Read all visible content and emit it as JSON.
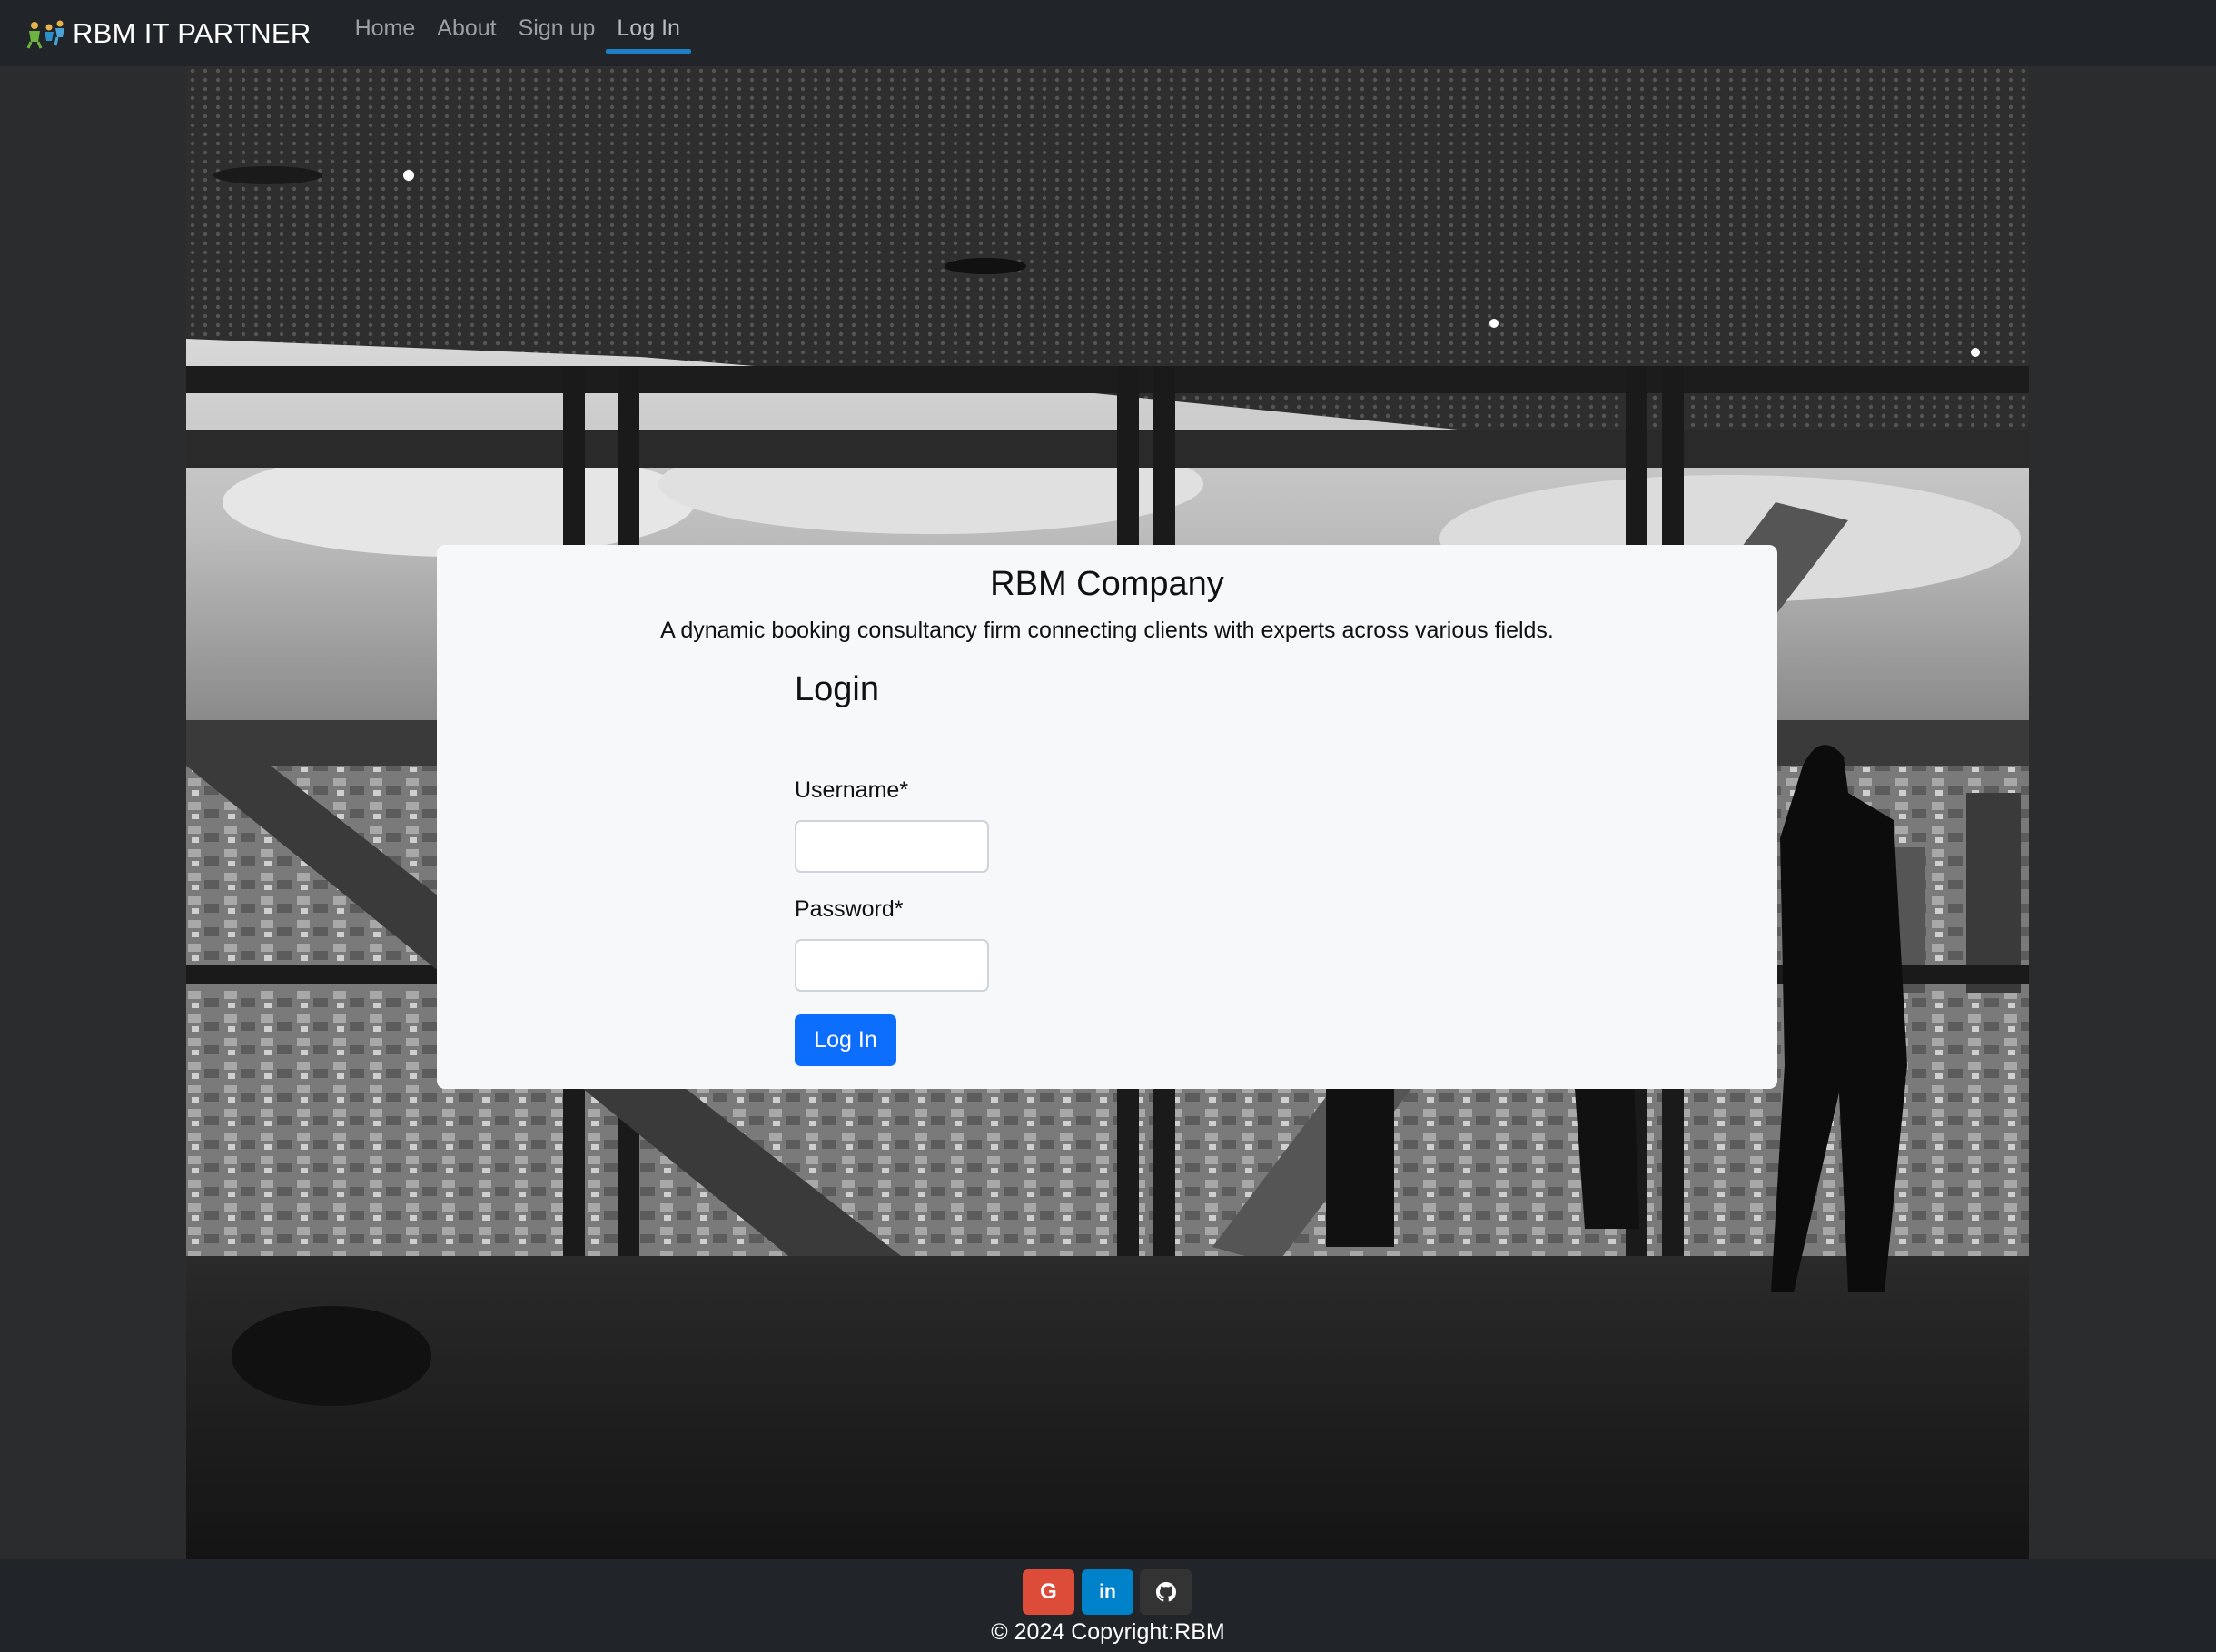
{
  "navbar": {
    "brand": "RBM IT PARTNER",
    "links": [
      {
        "label": "Home"
      },
      {
        "label": "About"
      },
      {
        "label": "Sign up"
      },
      {
        "label": "Log In",
        "active": true
      }
    ],
    "active_color": "#1f7fc4"
  },
  "card": {
    "company_name": "RBM Company",
    "description": "A dynamic booking consultancy firm connecting clients with experts across various fields.",
    "login_title": "Login",
    "username_label": "Username*",
    "username_value": "",
    "password_label": "Password*",
    "password_value": "",
    "submit_label": "Log In"
  },
  "footer": {
    "social": [
      {
        "icon": "google-icon",
        "glyph": "G",
        "color": "#dd4b39"
      },
      {
        "icon": "linkedin-icon",
        "glyph": "in",
        "color": "#0082ca"
      },
      {
        "icon": "github-icon",
        "glyph": "",
        "color": "#333333"
      }
    ],
    "copyright": "© 2024 Copyright:RBM"
  },
  "colors": {
    "navbar_bg": "#212529",
    "primary_button": "#0d6efd"
  }
}
